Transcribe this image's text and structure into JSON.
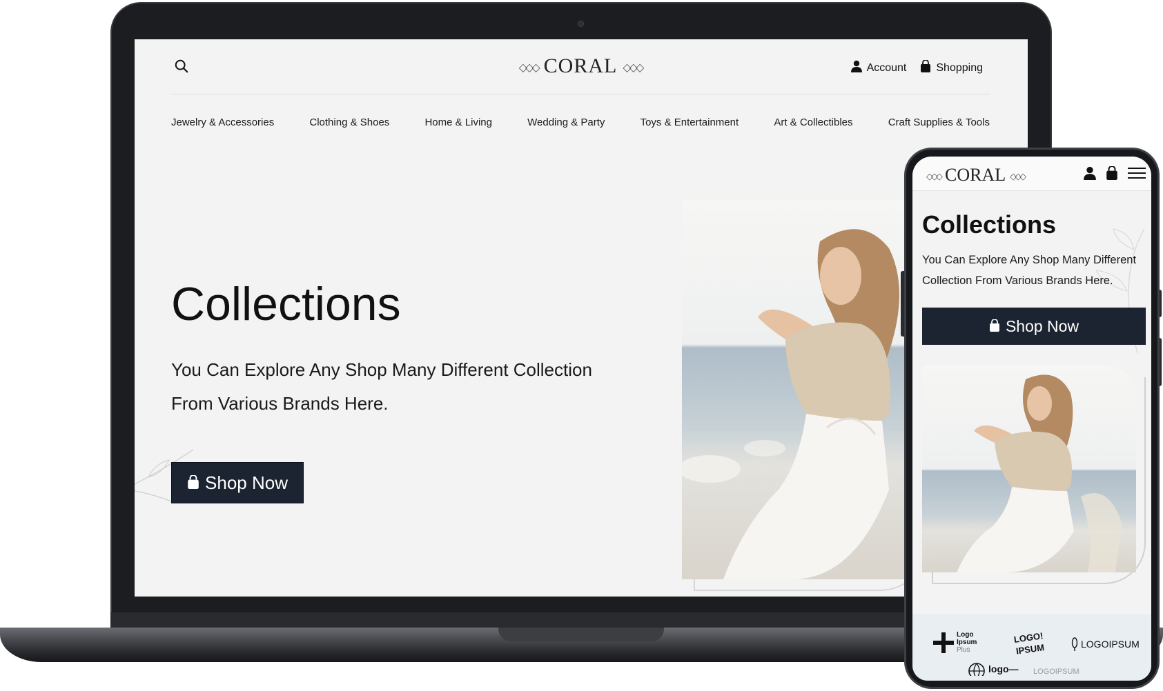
{
  "desktop": {
    "brand": "CORAL",
    "brand_ornament": "◇◇◇",
    "search_icon": "search-icon",
    "actions": {
      "account_label": "Account",
      "shopping_label": "Shopping"
    },
    "nav": [
      "Jewelry & Accessories",
      "Clothing & Shoes",
      "Home & Living",
      "Wedding & Party",
      "Toys & Entertainment",
      "Art & Collectibles",
      "Craft Supplies & Tools"
    ],
    "hero": {
      "title": "Collections",
      "text": "You Can Explore Any Shop Many Different Collection From Various Brands Here.",
      "button_label": "Shop Now"
    }
  },
  "mobile": {
    "brand": "CORAL",
    "brand_ornament": "◇◇◇",
    "hero": {
      "title": "Collections",
      "text": "You Can Explore Any Shop Many Different Collection From Various Brands Here.",
      "button_label": "Shop Now"
    },
    "partner_logos": [
      {
        "line1": "Logo",
        "line2": "Ipsum",
        "line3": "Plus"
      },
      {
        "line1": "LOGO!",
        "line2": "IPSUM"
      },
      {
        "line1": "LOGOIPSUM"
      },
      {
        "line1": "logo—"
      },
      {
        "line1": "LOGOIPSUM"
      }
    ]
  },
  "colors": {
    "background": "#f3f3f3",
    "button": "#1c2331",
    "text": "#111111",
    "device_frame": "#1c1d20"
  }
}
